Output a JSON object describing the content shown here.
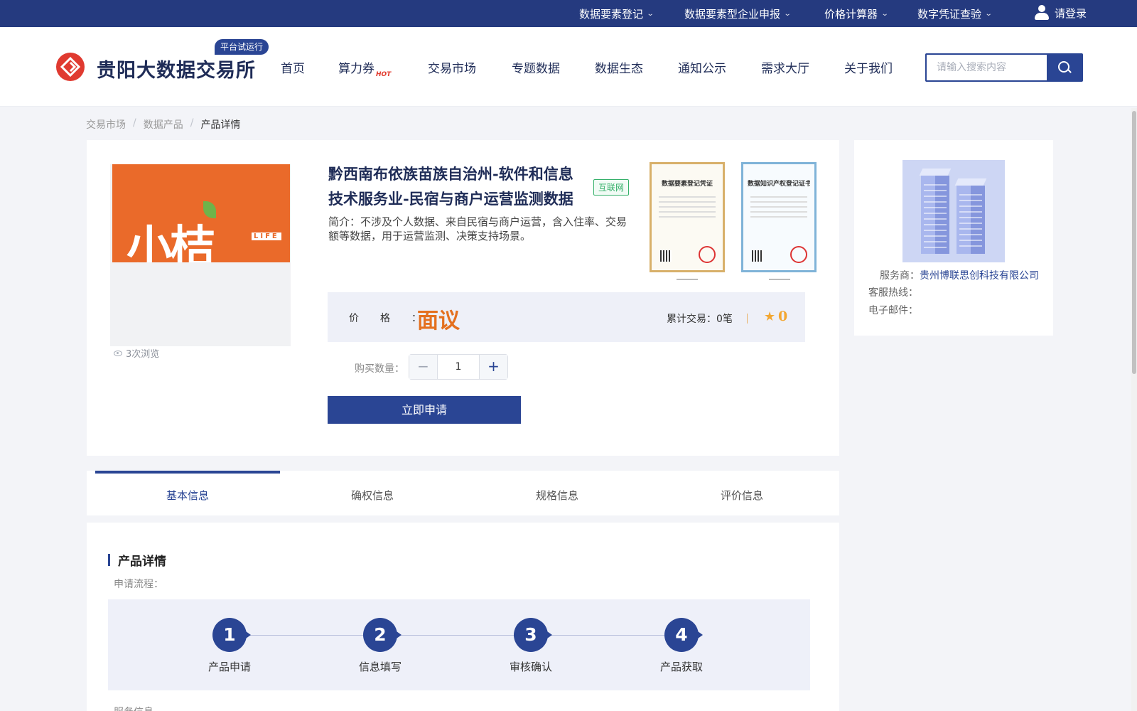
{
  "topbar": {
    "items": [
      {
        "label": "数据要素登记"
      },
      {
        "label": "数据要素型企业申报"
      },
      {
        "label": "价格计算器"
      },
      {
        "label": "数字凭证查验"
      }
    ],
    "login_label": "请登录"
  },
  "header": {
    "logo_text": "贵阳大数据交易所",
    "badge": "平台试运行",
    "nav": [
      {
        "label": "首页"
      },
      {
        "label": "算力券",
        "hot": "HOT"
      },
      {
        "label": "交易市场"
      },
      {
        "label": "专题数据"
      },
      {
        "label": "数据生态"
      },
      {
        "label": "通知公示"
      },
      {
        "label": "需求大厅"
      },
      {
        "label": "关于我们"
      }
    ],
    "search_placeholder": "请输入搜索内容"
  },
  "breadcrumb": {
    "items": [
      "交易市场",
      "数据产品",
      "产品详情"
    ],
    "separator": "/"
  },
  "product": {
    "image_text": "小桔",
    "image_subtext": "LIFE",
    "views": "3次浏览",
    "title": "黔西南布依族苗族自治州-软件和信息技术服务业-民宿与商户运营监测数据",
    "tag": "互联网",
    "description": "简介：不涉及个人数据、来自民宿与商户运营，含入住率、交易额等数据，用于运营监测、决策支持场景。",
    "certificates": [
      "数据要素登记凭证",
      "数据知识产权登记证书"
    ],
    "price_label": "价格：",
    "price_value": "面议",
    "trades_label": "累计交易：",
    "trades_value": "0笔",
    "star_icon": "star-icon",
    "rating": "0",
    "quantity_label": "购买数量：",
    "quantity_value": "1",
    "apply_label": "立即申请"
  },
  "provider": {
    "service_label": "服务商：",
    "company": "贵州博联思创科技有限公司",
    "hotline_label": "客服热线：",
    "email_label": "电子邮件："
  },
  "tabs": [
    {
      "label": "基本信息",
      "active": true
    },
    {
      "label": "确权信息"
    },
    {
      "label": "规格信息"
    },
    {
      "label": "评价信息"
    }
  ],
  "detail": {
    "section_title": "产品详情",
    "flow_label": "申请流程：",
    "steps": [
      {
        "num": "1",
        "label": "产品申请"
      },
      {
        "num": "2",
        "label": "信息填写"
      },
      {
        "num": "3",
        "label": "审核确认"
      },
      {
        "num": "4",
        "label": "产品获取"
      }
    ],
    "service_info_label": "服务信息"
  },
  "colors": {
    "primary": "#2a4594",
    "topbar": "#253a7f",
    "price": "#e4701f",
    "tag_green": "#35b06a",
    "logo_red": "#e03a30"
  }
}
